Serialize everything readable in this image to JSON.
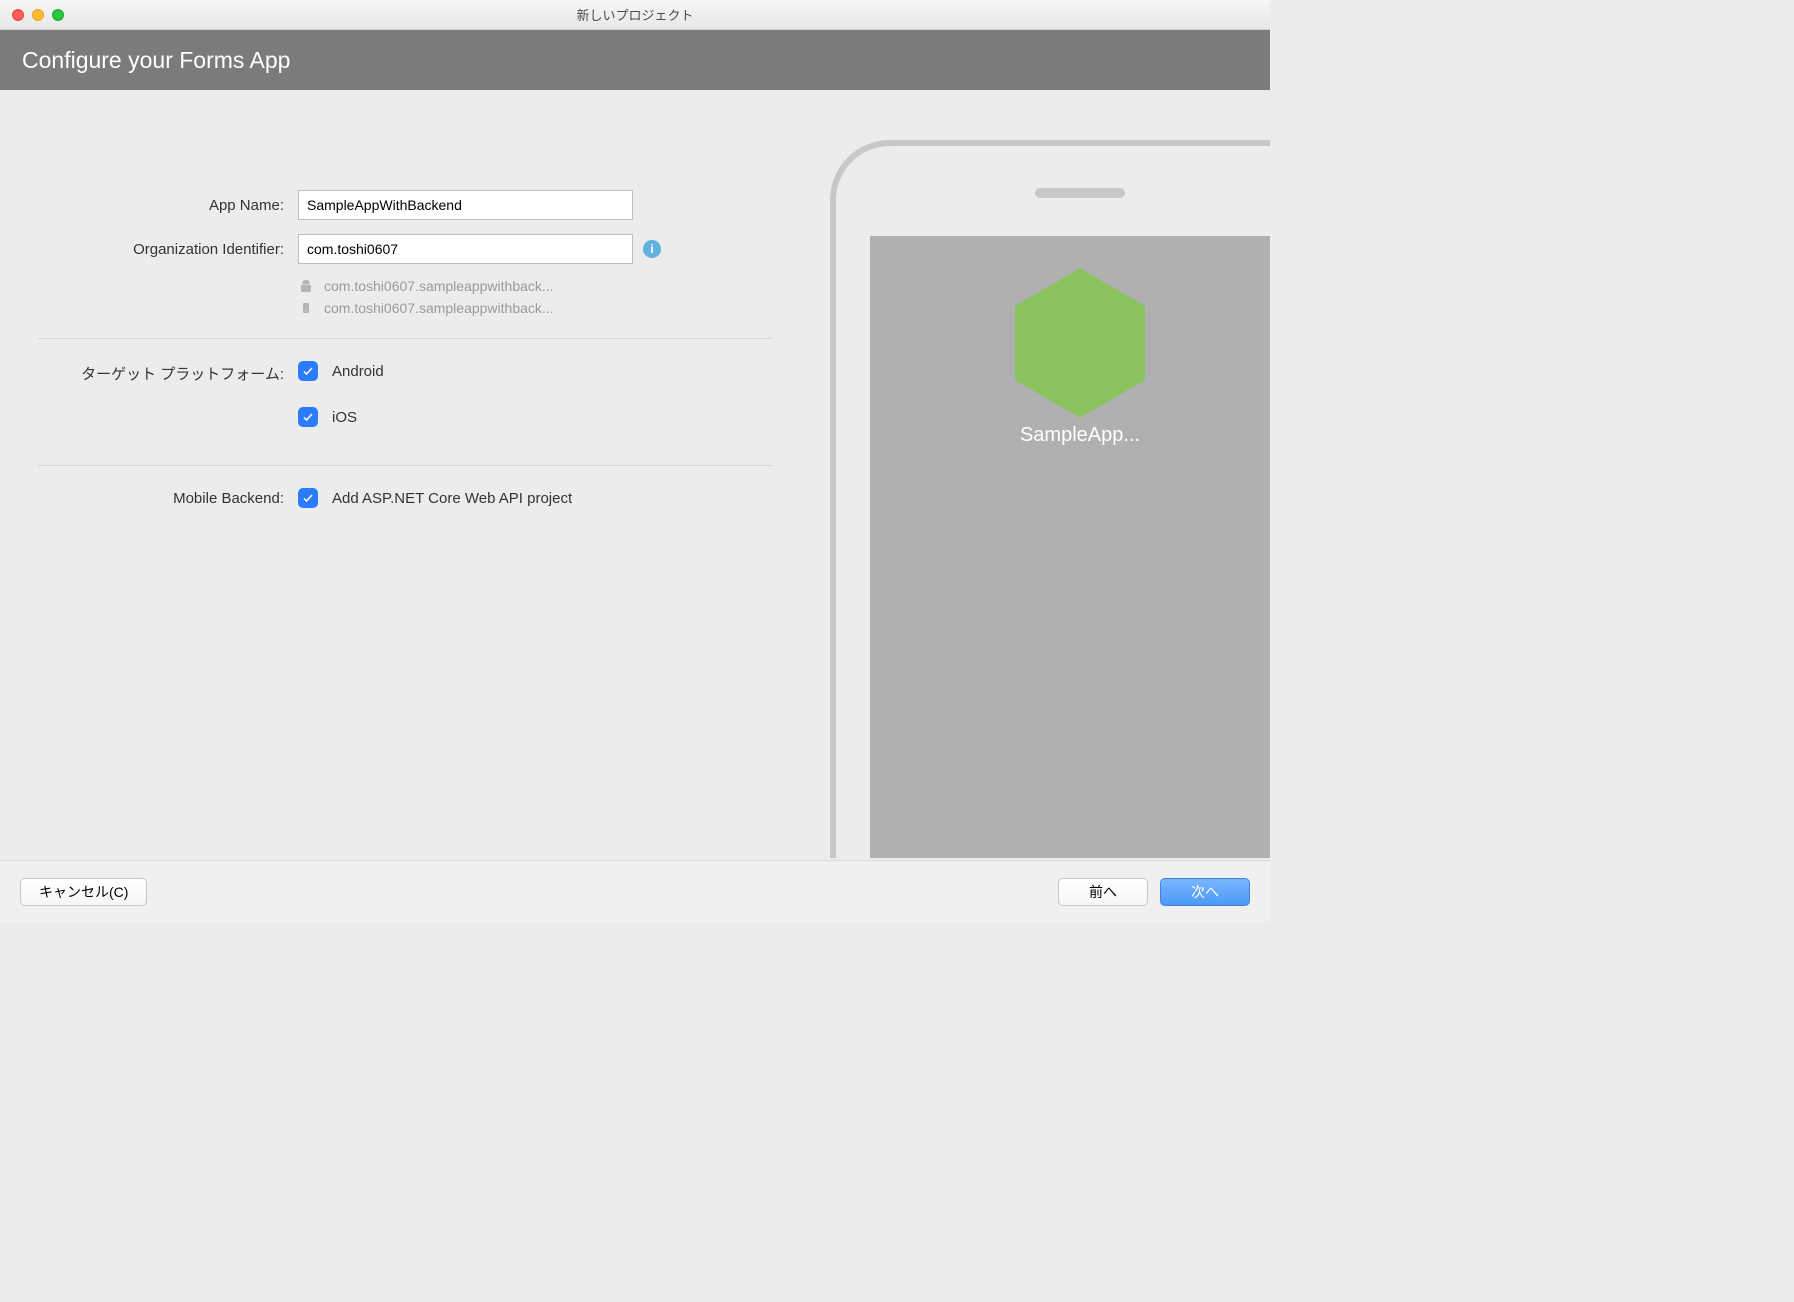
{
  "window": {
    "title": "新しいプロジェクト"
  },
  "header": {
    "title": "Configure your Forms App"
  },
  "form": {
    "appName": {
      "label": "App Name:",
      "value": "SampleAppWithBackend"
    },
    "orgId": {
      "label": "Organization Identifier:",
      "value": "com.toshi0607"
    },
    "hints": {
      "android": "com.toshi0607.sampleappwithback...",
      "ios": "com.toshi0607.sampleappwithback..."
    },
    "platforms": {
      "label": "ターゲット プラットフォーム:",
      "android": {
        "label": "Android",
        "checked": true
      },
      "ios": {
        "label": "iOS",
        "checked": true
      }
    },
    "backend": {
      "label": "Mobile Backend:",
      "option": {
        "label": "Add ASP.NET Core Web API project",
        "checked": true
      }
    }
  },
  "preview": {
    "appLabel": "SampleApp..."
  },
  "footer": {
    "cancel": "キャンセル(C)",
    "back": "前へ",
    "next": "次へ"
  },
  "colors": {
    "accentBlue": "#2b7bff",
    "hexGreen": "#8ac25d"
  }
}
